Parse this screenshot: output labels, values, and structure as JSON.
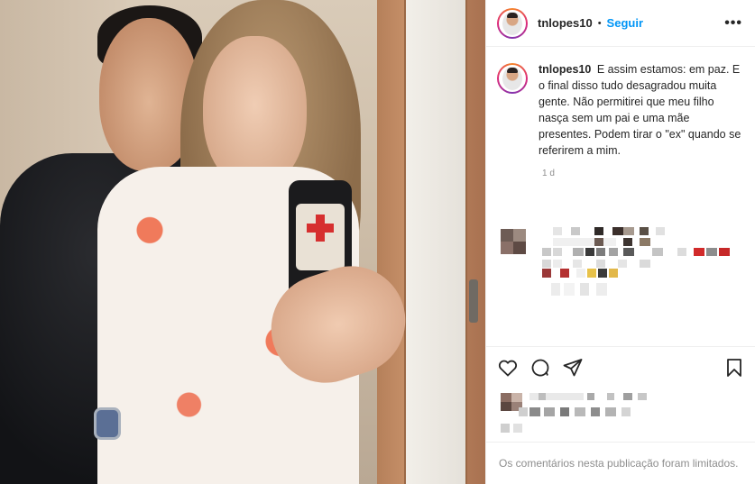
{
  "post": {
    "username": "tnlopes10",
    "follow_label": "Seguir",
    "separator": "•",
    "more_icon": "more-horizontal-icon"
  },
  "caption": {
    "username": "tnlopes10",
    "text": "E assim estamos: em paz. E o final disso tudo desagradou muita gente. Não permitirei que meu filho nasça sem um pai e uma mãe presentes. Podem tirar o \"ex\" quando se referirem a mim.",
    "timestamp": "1 d"
  },
  "actions": {
    "like_icon": "heart-icon",
    "comment_icon": "comment-icon",
    "share_icon": "share-icon",
    "save_icon": "bookmark-icon"
  },
  "footer": {
    "comments_limited": "Os comentários nesta publicação foram limitados."
  },
  "colors": {
    "link_blue": "#0095f6",
    "muted": "#8e8e8e",
    "text": "#262626",
    "border": "#efefef"
  }
}
